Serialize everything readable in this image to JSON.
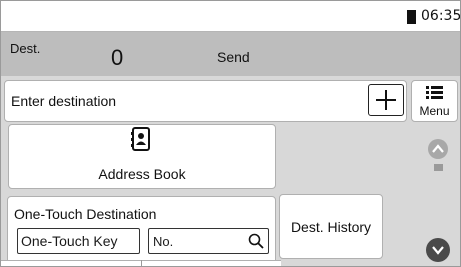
{
  "status": {
    "time": "06:35",
    "battery_icon": "battery-icon"
  },
  "dest_bar": {
    "label": "Dest.",
    "count": "0",
    "send": "Send"
  },
  "destination": {
    "placeholder": "Enter destination",
    "add_icon": "plus-icon"
  },
  "menu": {
    "label": "Menu",
    "icon": "list-icon"
  },
  "address_book": {
    "label": "Address Book",
    "icon": "address-book-icon"
  },
  "one_touch": {
    "title": "One-Touch Destination",
    "key_label": "One-Touch Key",
    "no_label": "No.",
    "search_icon": "search-icon"
  },
  "dest_history": {
    "label": "Dest. History"
  },
  "scroll": {
    "up_icon": "chevron-up-icon",
    "down_icon": "chevron-down-icon"
  },
  "colors": {
    "header_gray": "#bdbdbd",
    "panel_bg": "#d8d8d8",
    "scroll_down": "#4a4a4a",
    "scroll_up": "#a8a8a8"
  }
}
